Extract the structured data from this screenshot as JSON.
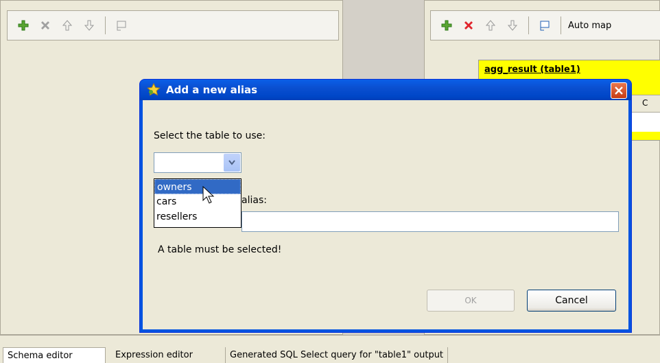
{
  "left_toolbar": {
    "icons": [
      "add-icon",
      "remove-icon",
      "move-up-icon",
      "move-down-icon",
      "copy-icon"
    ]
  },
  "right_toolbar": {
    "icons": [
      "add-icon",
      "remove-icon",
      "move-up-icon",
      "move-down-icon",
      "copy-icon"
    ],
    "auto_map_label": "Auto map"
  },
  "table_block": {
    "title": "agg_result (table1)",
    "col_letter": "C"
  },
  "dialog": {
    "title": "Add a new alias",
    "select_label": "Select the table to use:",
    "selected_value": "",
    "options": [
      "owners",
      "cars",
      "resellers"
    ],
    "alias_label": "alias:",
    "alias_value": "",
    "error_text": "A table must be selected!",
    "ok_label": "OK",
    "cancel_label": "Cancel"
  },
  "tabs": [
    "Schema editor",
    "Expression editor",
    "Generated SQL Select query for \"table1\" output"
  ],
  "colors": {
    "accent": "#0053e1",
    "highlight": "#316ac5",
    "yellow": "#ffff00"
  }
}
